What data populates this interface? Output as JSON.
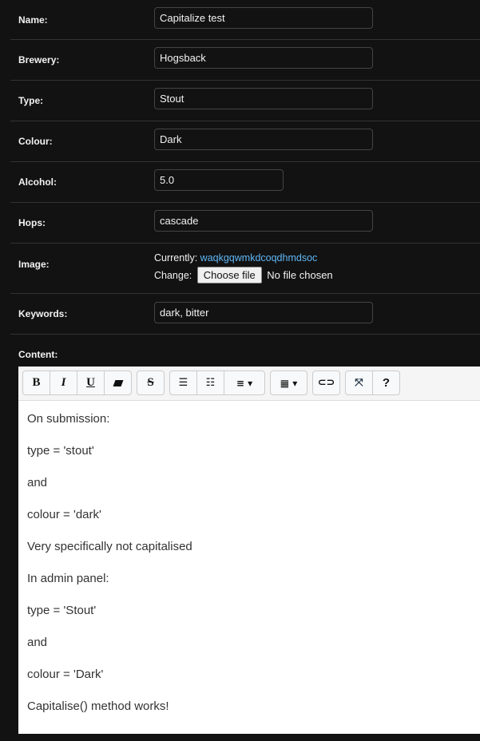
{
  "fields": {
    "name": {
      "label": "Name:",
      "value": "Capitalize test"
    },
    "brewery": {
      "label": "Brewery:",
      "value": "Hogsback"
    },
    "type": {
      "label": "Type:",
      "value": "Stout"
    },
    "colour": {
      "label": "Colour:",
      "value": "Dark"
    },
    "alcohol": {
      "label": "Alcohol:",
      "value": "5.0"
    },
    "hops": {
      "label": "Hops:",
      "value": "cascade"
    },
    "image": {
      "label": "Image:",
      "currently_label": "Currently:",
      "current_file": "waqkgqwmkdcoqdhmdsoc",
      "change_label": "Change:",
      "choose_button": "Choose file",
      "no_file": "No file chosen"
    },
    "keywords": {
      "label": "Keywords:",
      "value": "dark, bitter"
    },
    "content": {
      "label": "Content:"
    }
  },
  "toolbar": {
    "bold": "B",
    "italic": "I",
    "underline": "U",
    "help": "?"
  },
  "content_lines": [
    "On submission:",
    "type = 'stout'",
    "and",
    "colour = 'dark'",
    "Very specifically not capitalised",
    "In admin panel:",
    "type = 'Stout'",
    "and",
    "colour = 'Dark'",
    "Capitalise() method works!"
  ]
}
